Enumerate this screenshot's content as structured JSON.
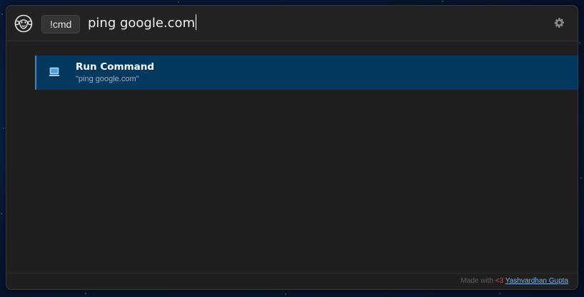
{
  "header": {
    "logo_icon": "monkey-face-icon",
    "tag_label": "!cmd",
    "query": "ping google.com",
    "settings_icon": "gear-icon"
  },
  "results": [
    {
      "icon": "laptop-icon",
      "title": "Run Command",
      "subtitle": "\"ping google.com\"",
      "selected": true
    }
  ],
  "footer": {
    "made_with": "Made with",
    "heart": "<3",
    "author": "Yashvardhan Gupta"
  },
  "colors": {
    "window_bg": "#1f1f1f",
    "selected_bg": "#03395f",
    "selected_accent": "#2a8ad6",
    "heart": "#e04343",
    "link": "#7fb2e6"
  }
}
